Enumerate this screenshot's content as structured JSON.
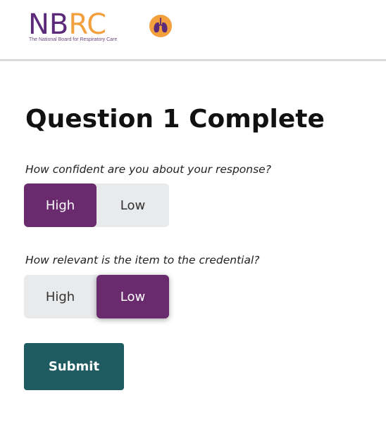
{
  "header": {
    "logo": {
      "text_nb": "NB",
      "text_rc": "RC",
      "icon": "lungs-icon",
      "tagline": "The National Board for Respiratory Care",
      "colors": {
        "primary": "#5b2a78",
        "accent": "#f2a03d"
      }
    }
  },
  "main": {
    "title": "Question 1 Complete",
    "confidence": {
      "prompt": "How confident are you about your response?",
      "options": [
        "High",
        "Low"
      ],
      "selected": "High"
    },
    "relevance": {
      "prompt": "How relevant is the item to the credential?",
      "options": [
        "High",
        "Low"
      ],
      "selected": "Low"
    },
    "submit_label": "Submit"
  },
  "colors": {
    "selected_bg": "#6a2a6e",
    "toggle_bg": "#e9eaec",
    "submit_bg": "#1f5c61"
  }
}
